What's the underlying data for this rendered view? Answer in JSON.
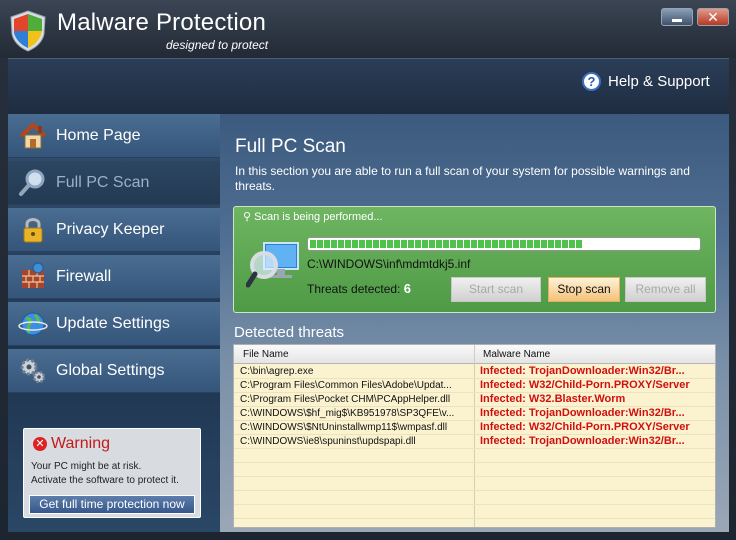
{
  "app": {
    "title": "Malware Protection",
    "subtitle": "designed to protect",
    "close_glyph": "✕"
  },
  "header": {
    "help_label": "Help & Support",
    "help_glyph": "?"
  },
  "sidebar": {
    "items": [
      {
        "label": "Home Page",
        "icon": "house-icon",
        "active": false
      },
      {
        "label": "Full PC Scan",
        "icon": "magnifier-icon",
        "active": true
      },
      {
        "label": "Privacy Keeper",
        "icon": "padlock-icon",
        "active": false
      },
      {
        "label": "Firewall",
        "icon": "brick-wall-icon",
        "active": false
      },
      {
        "label": "Update Settings",
        "icon": "globe-icon",
        "active": false
      },
      {
        "label": "Global Settings",
        "icon": "gears-icon",
        "active": false
      }
    ]
  },
  "warning": {
    "title": "Warning",
    "glyph": "✕",
    "line1": "Your PC might be at risk.",
    "line2": "Activate the software to protect it.",
    "button_label": "Get full time protection now"
  },
  "main": {
    "title": "Full PC Scan",
    "description": "In this section you are able to run a full scan of your system for possible warnings and threats."
  },
  "scan": {
    "status": "Scan is being performed...",
    "progress": 0.7,
    "current_file": "C:\\WINDOWS\\inf\\mdmtdkj5.inf",
    "threats_label": "Threats detected:",
    "threats_count": "6",
    "start_label": "Start scan",
    "stop_label": "Stop scan",
    "remove_label": "Remove all"
  },
  "detected": {
    "title": "Detected threats",
    "columns": [
      "File Name",
      "Malware Name"
    ],
    "rows": [
      {
        "file": "C:\\bin\\agrep.exe",
        "malware": "Infected: TrojanDownloader:Win32/Br..."
      },
      {
        "file": "C:\\Program Files\\Common Files\\Adobe\\Updat...",
        "malware": "Infected: W32/Child-Porn.PROXY/Server"
      },
      {
        "file": "C:\\Program Files\\Pocket CHM\\PCAppHelper.dll",
        "malware": "Infected: W32.Blaster.Worm"
      },
      {
        "file": "C:\\WINDOWS\\$hf_mig$\\KB951978\\SP3QFE\\v...",
        "malware": "Infected: TrojanDownloader:Win32/Br..."
      },
      {
        "file": "C:\\WINDOWS\\$NtUninstallwmp11$\\wmpasf.dll",
        "malware": "Infected: W32/Child-Porn.PROXY/Server"
      },
      {
        "file": "C:\\WINDOWS\\ie8\\spuninst\\updspapi.dll",
        "malware": "Infected: TrojanDownloader:Win32/Br..."
      }
    ]
  },
  "colors": {
    "accent_green": "#4e9a45",
    "threat_red": "#d0100f",
    "warning_red": "#c41a1a"
  }
}
